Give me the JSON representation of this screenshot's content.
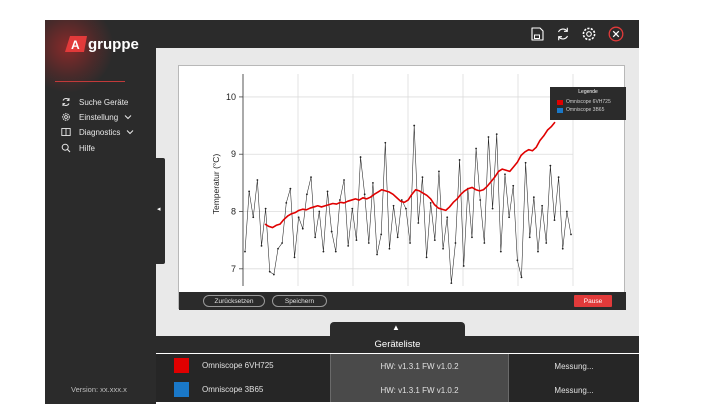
{
  "brand": {
    "logo_mark": "A",
    "logo_text": "gruppe",
    "accent": "#e23a3a"
  },
  "sidebar": {
    "items": [
      {
        "label": "Suche Geräte",
        "icon": "refresh-icon",
        "has_submenu": false
      },
      {
        "label": "Einstellung",
        "icon": "gear-icon",
        "has_submenu": true
      },
      {
        "label": "Diagnostics",
        "icon": "book-icon",
        "has_submenu": true
      },
      {
        "label": "Hilfe",
        "icon": "search-icon",
        "has_submenu": false
      }
    ],
    "version": "Version: xx.xxx.x"
  },
  "topbar": {
    "icons": [
      "save-icon",
      "refresh-icon",
      "gear-icon",
      "close-icon"
    ]
  },
  "chart_controls": {
    "reset_label": "Zurücksetzen",
    "save_label": "Speichern",
    "pause_label": "Pause"
  },
  "legend": {
    "title": "Legende",
    "entries": [
      {
        "label": "Omniscope 6VH725",
        "color": "#e00000"
      },
      {
        "label": "Omniscope 3B65",
        "color": "#1a78c8"
      }
    ]
  },
  "device_list": {
    "title": "Geräteliste",
    "rows": [
      {
        "name": "Omniscope 6VH725",
        "color": "#e00000",
        "version": "HW: v1.3.1 FW v1.0.2",
        "status": "Messung..."
      },
      {
        "name": "Omniscope 3B65",
        "color": "#1a78c8",
        "version": "HW: v1.3.1 FW v1.0.2",
        "status": "Messung..."
      }
    ]
  },
  "chart_data": {
    "type": "line",
    "ylabel": "Temperatur (°C)",
    "xlabel": "",
    "ylim": [
      6.7,
      10.4
    ],
    "yticks": [
      7,
      8,
      9,
      10
    ],
    "grid": true,
    "series": [
      {
        "name": "Omniscope 6VH725",
        "color": "#e00000",
        "values": [
          7.78,
          7.74,
          7.72,
          7.76,
          7.78,
          7.86,
          7.92,
          7.96,
          7.98,
          8.02,
          8.04,
          8.03,
          8.06,
          8.08,
          8.1,
          8.08,
          8.1,
          8.12,
          8.14,
          8.13,
          8.16,
          8.15,
          8.18,
          8.2,
          8.22,
          8.2,
          8.24,
          8.22,
          8.25,
          8.3,
          8.34,
          8.38,
          8.36,
          8.34,
          8.3,
          8.24,
          8.18,
          8.16,
          8.2,
          8.3,
          8.38,
          8.36,
          8.32,
          8.28,
          8.22,
          8.12,
          8.06,
          8.04,
          8.02,
          8.08,
          8.16,
          8.22,
          8.3,
          8.36,
          8.4,
          8.42,
          8.38,
          8.36,
          8.38,
          8.44,
          8.52,
          8.6,
          8.7,
          8.74,
          8.72,
          8.7,
          8.78,
          8.86,
          8.98,
          9.04,
          9.08,
          9.06,
          9.12,
          9.24,
          9.32,
          9.42,
          9.48,
          9.56
        ]
      },
      {
        "name": "",
        "color": "#222222",
        "values": [
          7.3,
          8.35,
          7.9,
          8.55,
          7.4,
          8.05,
          6.95,
          6.9,
          7.35,
          7.45,
          8.15,
          8.4,
          7.2,
          7.9,
          7.7,
          8.3,
          8.6,
          7.55,
          8.0,
          7.3,
          8.35,
          7.65,
          7.3,
          8.2,
          8.55,
          7.4,
          8.05,
          7.5,
          8.95,
          8.3,
          7.45,
          8.5,
          7.25,
          7.6,
          9.2,
          7.35,
          8.1,
          7.55,
          8.2,
          8.05,
          7.45,
          9.5,
          7.8,
          8.6,
          7.2,
          8.15,
          7.5,
          8.7,
          7.35,
          7.9,
          6.75,
          7.45,
          8.9,
          7.05,
          8.4,
          7.55,
          9.1,
          8.2,
          7.45,
          9.3,
          8.05,
          9.35,
          7.3,
          8.65,
          7.9,
          8.45,
          7.15,
          6.85,
          8.85,
          7.55,
          8.25,
          7.3,
          8.1,
          7.45,
          8.8,
          7.85,
          8.6,
          7.35,
          8.0,
          7.6
        ]
      }
    ]
  }
}
